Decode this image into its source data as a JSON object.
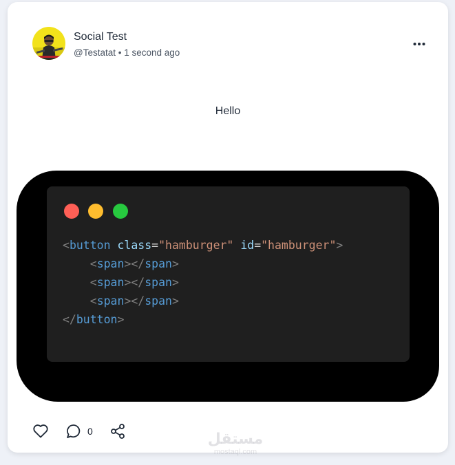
{
  "post": {
    "author": {
      "name": "Social Test",
      "handle": "@Testatat",
      "time": "1 second ago"
    },
    "separator": "•",
    "text": "Hello",
    "more_icon": "more-horizontal-icon"
  },
  "code_window": {
    "dots": [
      "#ff5f56",
      "#ffbd2e",
      "#27c93f"
    ],
    "lines": [
      [
        [
          "<",
          "#808080"
        ],
        [
          "button",
          "#569cd6"
        ],
        [
          " ",
          "#d4d4d4"
        ],
        [
          "class",
          "#9cdcfe"
        ],
        [
          "=",
          "#d4d4d4"
        ],
        [
          "\"hamburger\"",
          "#ce9178"
        ],
        [
          " ",
          "#d4d4d4"
        ],
        [
          "id",
          "#9cdcfe"
        ],
        [
          "=",
          "#d4d4d4"
        ],
        [
          "\"hamburger\"",
          "#ce9178"
        ],
        [
          ">",
          "#808080"
        ]
      ],
      [
        [
          "    ",
          "#d4d4d4"
        ],
        [
          "<",
          "#808080"
        ],
        [
          "span",
          "#569cd6"
        ],
        [
          "></",
          "#808080"
        ],
        [
          "span",
          "#569cd6"
        ],
        [
          ">",
          "#808080"
        ]
      ],
      [
        [
          "    ",
          "#d4d4d4"
        ],
        [
          "<",
          "#808080"
        ],
        [
          "span",
          "#569cd6"
        ],
        [
          "></",
          "#808080"
        ],
        [
          "span",
          "#569cd6"
        ],
        [
          ">",
          "#808080"
        ]
      ],
      [
        [
          "    ",
          "#d4d4d4"
        ],
        [
          "<",
          "#808080"
        ],
        [
          "span",
          "#569cd6"
        ],
        [
          "></",
          "#808080"
        ],
        [
          "span",
          "#569cd6"
        ],
        [
          ">",
          "#808080"
        ]
      ],
      [
        [
          "</",
          "#808080"
        ],
        [
          "button",
          "#569cd6"
        ],
        [
          ">",
          "#808080"
        ]
      ]
    ]
  },
  "actions": {
    "like_icon": "heart-icon",
    "comment_icon": "comment-icon",
    "comment_count": "0",
    "share_icon": "share-icon"
  },
  "watermark": {
    "text_ar": "مستقل",
    "text": "mostaql.com"
  }
}
